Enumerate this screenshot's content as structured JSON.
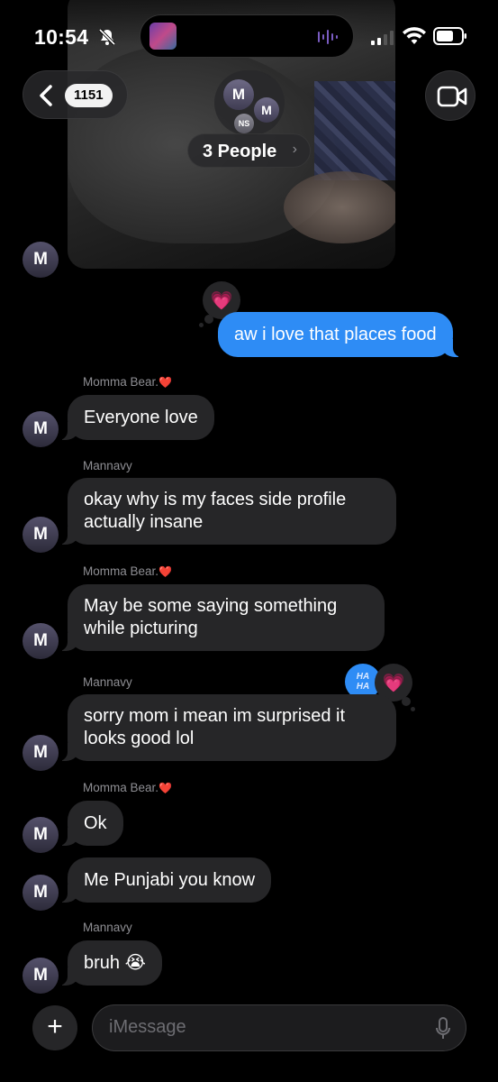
{
  "status_bar": {
    "time": "10:54"
  },
  "header": {
    "back_badge": "1151",
    "group_avatar_1": "M",
    "group_avatar_2": "M",
    "group_avatar_3": "NS",
    "title": "3 People",
    "chevron": "›"
  },
  "messages": [
    {
      "id": "photo",
      "type": "photo",
      "avatar": "M"
    },
    {
      "id": "out1",
      "type": "outgoing",
      "text": "aw i love that places food",
      "tapback": "heart"
    },
    {
      "id": "m1",
      "sender": "Momma Bear.",
      "sender_emoji": "❤️",
      "text_lines": [
        "Everyone love"
      ],
      "avatar": "M"
    },
    {
      "id": "m2",
      "sender": "Mannavy",
      "text_lines": [
        "okay why is my faces side profile",
        "actually insane"
      ],
      "avatar": "M"
    },
    {
      "id": "m3",
      "sender": "Momma Bear.",
      "sender_emoji": "❤️",
      "text_lines": [
        "May be some saying something",
        "while picturing"
      ],
      "avatar": "M"
    },
    {
      "id": "m4",
      "sender": "Mannavy",
      "text_lines": [
        "sorry mom i mean im surprised it",
        "looks good lol"
      ],
      "avatar": "M",
      "tapbacks": [
        "haha",
        "heart"
      ]
    },
    {
      "id": "m5",
      "sender": "Momma Bear.",
      "sender_emoji": "❤️",
      "text_lines": [
        "Ok"
      ],
      "avatar": "M"
    },
    {
      "id": "m6",
      "text_lines": [
        "Me Punjabi you know"
      ],
      "avatar": "M"
    },
    {
      "id": "m7",
      "sender": "Mannavy",
      "text_lines": [
        "bruh 😭"
      ],
      "avatar": "M"
    }
  ],
  "tapback_glyphs": {
    "heart": "💗",
    "haha_top": "HA",
    "haha_bottom": "HA"
  },
  "composer": {
    "plus": "+",
    "placeholder": "iMessage"
  },
  "colors": {
    "outgoing": "#2e8cf5",
    "incoming": "#262628",
    "background": "#000000"
  }
}
